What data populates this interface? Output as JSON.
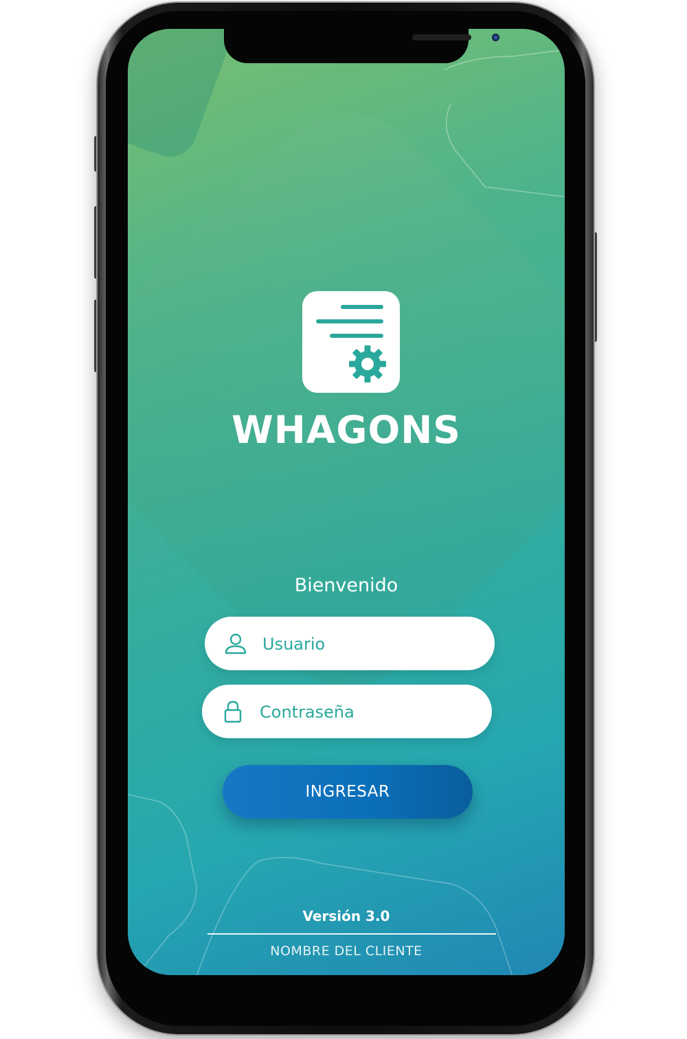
{
  "app": {
    "name": "WHAGONS",
    "logo_icon": "document-settings-icon"
  },
  "login": {
    "welcome": "Bienvenido",
    "username": {
      "placeholder": "Usuario",
      "value": "",
      "icon": "user-icon"
    },
    "password": {
      "placeholder": "Contraseña",
      "value": "",
      "icon": "lock-icon"
    },
    "submit_label": "INGRESAR"
  },
  "footer": {
    "version": "Versión 3.0",
    "client_name": "NOMBRE DEL CLIENTE"
  },
  "colors": {
    "gradient_top": "#7abf6f",
    "gradient_mid": "#34ad9e",
    "gradient_bottom": "#2087b5",
    "accent_teal": "#2aa89c",
    "button_blue": "#0a6fb9"
  }
}
